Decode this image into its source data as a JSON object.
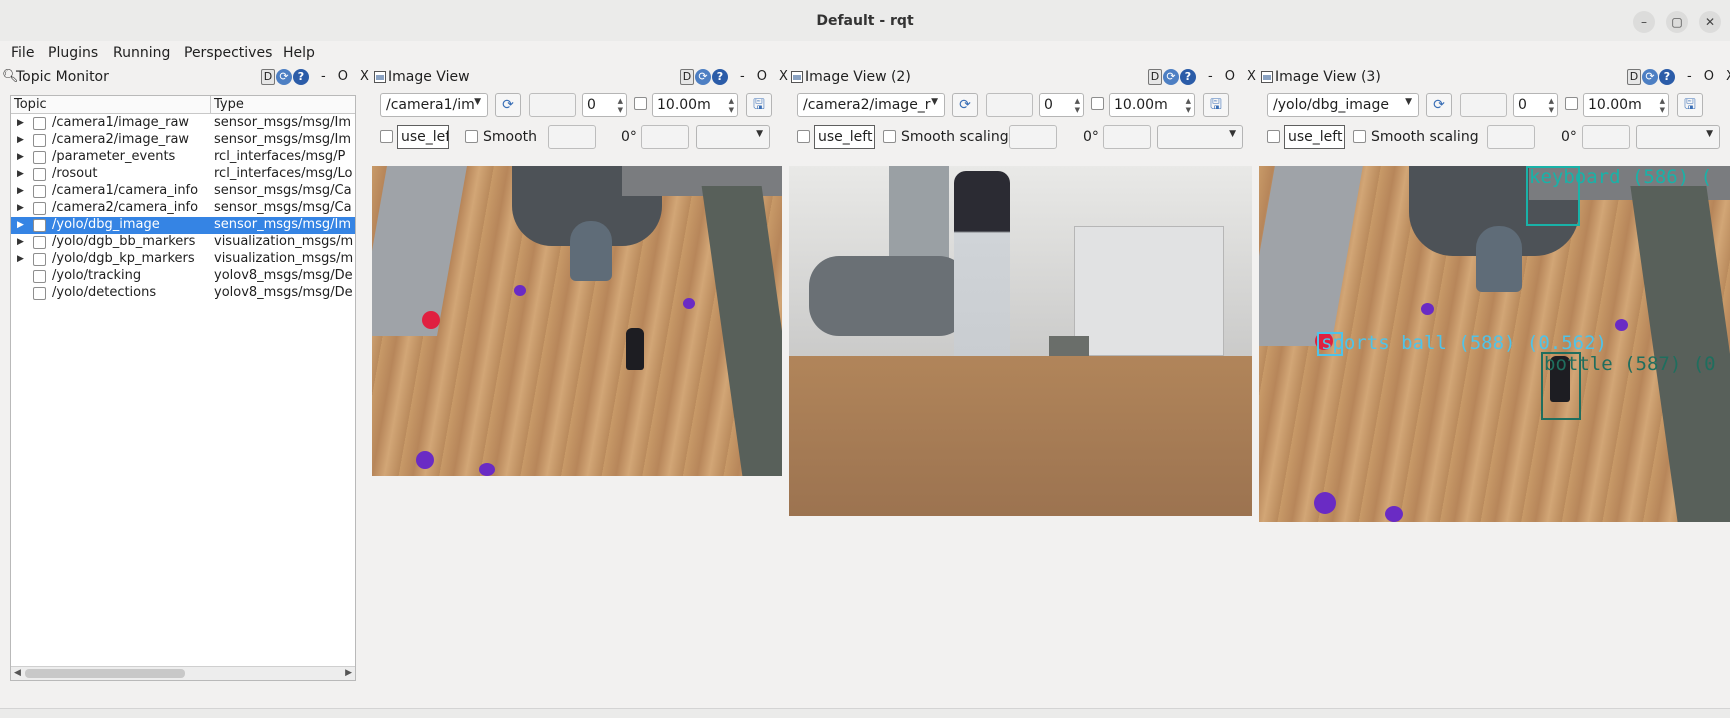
{
  "window": {
    "title": "Default - rqt"
  },
  "menubar": {
    "items": [
      "File",
      "Plugins",
      "Running",
      "Perspectives",
      "Help"
    ]
  },
  "dock_buttons": {
    "d": "D",
    "minimize": "-",
    "restore": "O",
    "close": "X"
  },
  "topic_monitor": {
    "title": "Topic Monitor",
    "columns": {
      "topic": "Topic",
      "type": "Type"
    },
    "rows": [
      {
        "topic": "/camera1/image_raw",
        "type": "sensor_msgs/msg/Im",
        "expandable": true,
        "selected": false
      },
      {
        "topic": "/camera2/image_raw",
        "type": "sensor_msgs/msg/Im",
        "expandable": true,
        "selected": false
      },
      {
        "topic": "/parameter_events",
        "type": "rcl_interfaces/msg/P",
        "expandable": true,
        "selected": false
      },
      {
        "topic": "/rosout",
        "type": "rcl_interfaces/msg/Lo",
        "expandable": true,
        "selected": false
      },
      {
        "topic": "/camera1/camera_info",
        "type": "sensor_msgs/msg/Ca",
        "expandable": true,
        "selected": false
      },
      {
        "topic": "/camera2/camera_info",
        "type": "sensor_msgs/msg/Ca",
        "expandable": true,
        "selected": false
      },
      {
        "topic": "/yolo/dbg_image",
        "type": "sensor_msgs/msg/Im",
        "expandable": true,
        "selected": true
      },
      {
        "topic": "/yolo/dgb_bb_markers",
        "type": "visualization_msgs/m",
        "expandable": true,
        "selected": false
      },
      {
        "topic": "/yolo/dgb_kp_markers",
        "type": "visualization_msgs/m",
        "expandable": true,
        "selected": false
      },
      {
        "topic": "/yolo/tracking",
        "type": "yolov8_msgs/msg/De",
        "expandable": false,
        "selected": false
      },
      {
        "topic": "/yolo/detections",
        "type": "yolov8_msgs/msg/De",
        "expandable": false,
        "selected": false
      }
    ]
  },
  "image_views": [
    {
      "title": "Image View",
      "topic": "/camera1/im",
      "spin_value": "0",
      "rate_value": "10.00m",
      "use_left": "use_left",
      "smooth_label": "Smooth",
      "rotation": "0°"
    },
    {
      "title": "Image View (2)",
      "topic": "/camera2/image_r",
      "spin_value": "0",
      "rate_value": "10.00m",
      "use_left": "use_left",
      "smooth_label": "Smooth scaling",
      "rotation": "0°"
    },
    {
      "title": "Image View (3)",
      "topic": "/yolo/dbg_image",
      "spin_value": "0",
      "rate_value": "10.00m",
      "use_left": "use_left",
      "smooth_label": "Smooth scaling",
      "rotation": "0°"
    }
  ],
  "detections": {
    "keyboard": "keyboard (586) (",
    "sports_ball": "sports ball (588) (0.562)",
    "bottle": "bottle (587) (0"
  },
  "colors": {
    "selection": "#3584e4",
    "keyboard_box": "#19b2a8",
    "sports_ball_box": "#4fc3e8",
    "bottle_box": "#1f6e5e",
    "purple_markers": "#6a2bc4"
  }
}
